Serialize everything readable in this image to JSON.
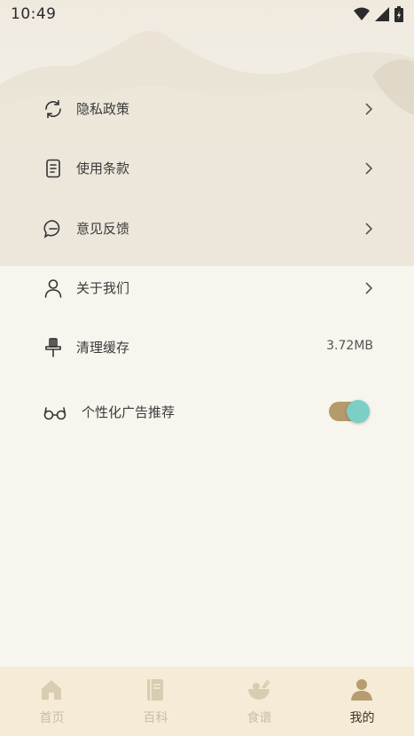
{
  "status_bar": {
    "time": "10:49"
  },
  "menu": {
    "items": [
      {
        "label": "隐私政策",
        "icon": "refresh-cycle-icon"
      },
      {
        "label": "使用条款",
        "icon": "document-icon"
      },
      {
        "label": "意见反馈",
        "icon": "chat-bubble-icon"
      },
      {
        "label": "关于我们",
        "icon": "user-icon"
      },
      {
        "label": "清理缓存",
        "icon": "broom-icon",
        "value": "3.72MB"
      },
      {
        "label": "个性化广告推荐",
        "icon": "glasses-icon",
        "toggle_on": true
      }
    ]
  },
  "tabbar": {
    "tabs": [
      {
        "label": "首页",
        "icon": "home-icon"
      },
      {
        "label": "百科",
        "icon": "book-icon"
      },
      {
        "label": "食谱",
        "icon": "bowl-icon"
      },
      {
        "label": "我的",
        "icon": "profile-icon",
        "active": true
      }
    ]
  },
  "colors": {
    "background": "#f8f5ee",
    "tabbar_bg": "#f5ebd6",
    "toggle_track": "#b59a6b",
    "toggle_knob": "#7ccfc6",
    "active_tab_icon": "#b79c72",
    "inactive_tab": "#d8ccb1"
  }
}
